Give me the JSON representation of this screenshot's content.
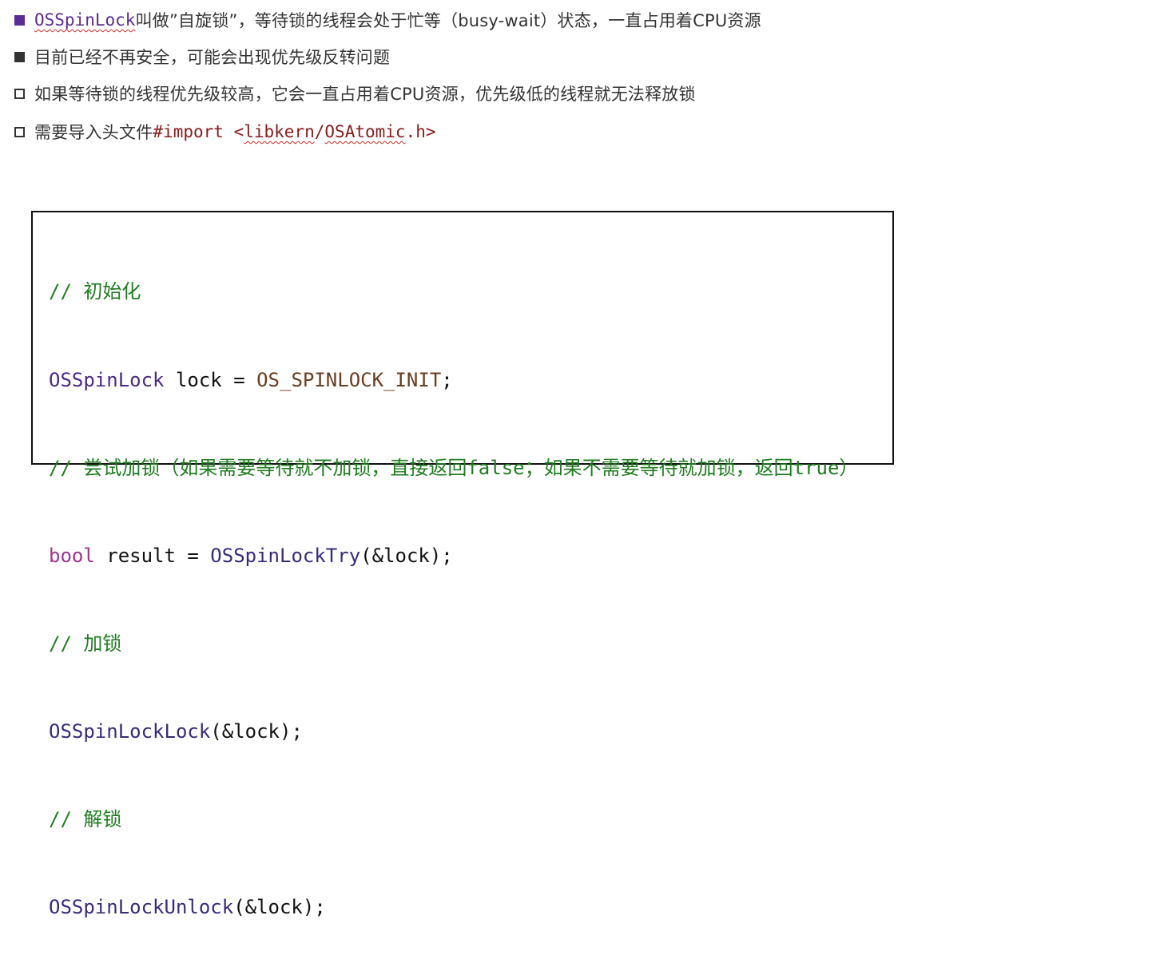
{
  "bullets": [
    {
      "marker": "filled-purple-square",
      "term": "OSSpinLock",
      "text": "叫做”自旋锁”，等待锁的线程会处于忙等（busy-wait）状态，一直占用着CPU资源"
    },
    {
      "marker": "filled-gray-square",
      "text": "目前已经不再安全，可能会出现优先级反转问题"
    },
    {
      "marker": "hollow-square",
      "text": "如果等待锁的线程优先级较高，它会一直占用着CPU资源，优先级低的线程就无法释放锁"
    },
    {
      "marker": "hollow-square",
      "text": "需要导入头文件",
      "directive": "#import",
      "header_open": "<",
      "header_lib": "libkern",
      "header_sep": "/",
      "header_file": "OSAtomic",
      "header_close": ".h>"
    }
  ],
  "code": {
    "comment_init": "// 初始化",
    "line1_type": "OSSpinLock",
    "line1_mid": " lock = ",
    "line1_macro": "OS_SPINLOCK_INIT",
    "line1_end": ";",
    "comment_try": "// 尝试加锁（如果需要等待就不加锁，直接返回false；如果不需要等待就加锁，返回true）",
    "line2_kw": "bool",
    "line2_mid": " result = ",
    "line2_func": "OSSpinLockTry",
    "line2_end": "(&lock);",
    "comment_lock": "// 加锁",
    "line3_func": "OSSpinLockLock",
    "line3_end": "(&lock);",
    "comment_unlock": "// 解锁",
    "line4_func": "OSSpinLockUnlock",
    "line4_end": "(&lock);"
  },
  "colors": {
    "accent_purple": "#5b2c91",
    "comment_green": "#1f7d1f",
    "keyword_magenta": "#a0338e",
    "macro_brown": "#6b3d1f",
    "spellcheck_red": "#d62c2c"
  }
}
